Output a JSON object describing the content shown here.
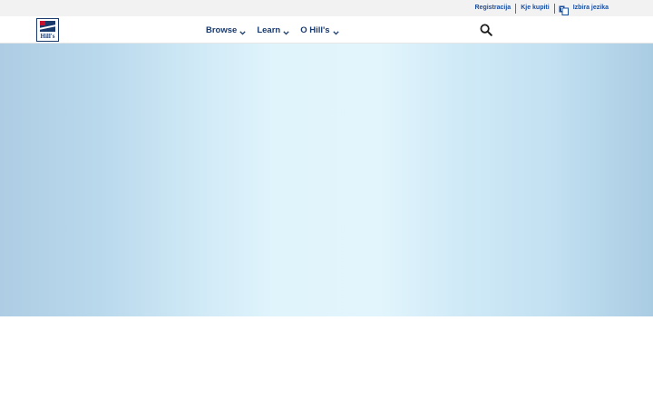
{
  "brand": {
    "logo_text": "Hill's"
  },
  "utility_bar": {
    "links": [
      "Registracija",
      "Kje kupiti"
    ],
    "language_label": "Izbira jezika"
  },
  "nav": {
    "items": [
      {
        "label": "Browse"
      },
      {
        "label": "Learn"
      },
      {
        "label": "O Hill's"
      }
    ]
  },
  "colors": {
    "nav_text": "#1a3a6b",
    "utility_link": "#1a4fa0",
    "hero_edge": "#aecde4",
    "hero_center": "#e0f4fc"
  }
}
